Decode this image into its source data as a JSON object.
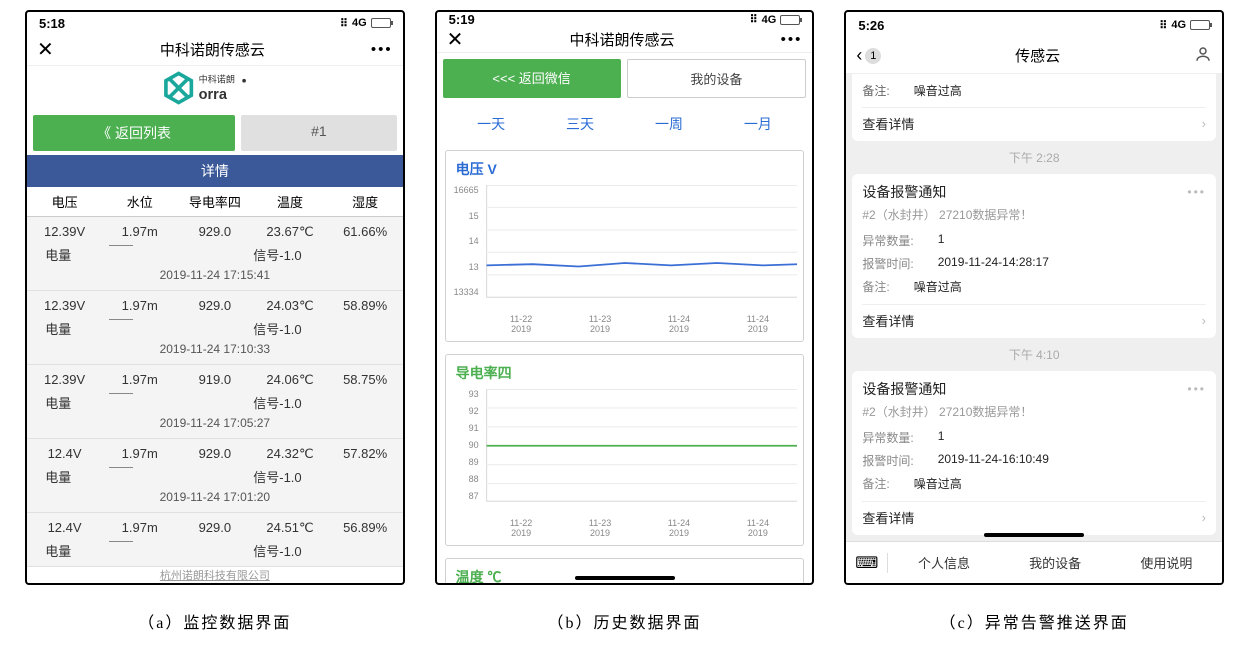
{
  "panelA": {
    "status_time": "5:18",
    "status_signal": "4G",
    "title": "中科诺朗传感云",
    "logo_text": "中科诺朗",
    "logo_sub": "orra",
    "btn_return": "《 返回列表",
    "btn_id": "#1",
    "details_header": "详情",
    "columns": [
      "电压",
      "水位",
      "导电率四",
      "温度",
      "湿度"
    ],
    "row2_label_left": "电量",
    "row2_label_signal": "信号-1.0",
    "records": [
      {
        "vals": [
          "12.39V",
          "1.97m",
          "929.0",
          "23.67℃",
          "61.66%"
        ],
        "ts": "2019-11-24 17:15:41"
      },
      {
        "vals": [
          "12.39V",
          "1.97m",
          "929.0",
          "24.03℃",
          "58.89%"
        ],
        "ts": "2019-11-24 17:10:33"
      },
      {
        "vals": [
          "12.39V",
          "1.97m",
          "919.0",
          "24.06℃",
          "58.75%"
        ],
        "ts": "2019-11-24 17:05:27"
      },
      {
        "vals": [
          "12.4V",
          "1.97m",
          "929.0",
          "24.32℃",
          "57.82%"
        ],
        "ts": "2019-11-24 17:01:20"
      },
      {
        "vals": [
          "12.4V",
          "1.97m",
          "929.0",
          "24.51℃",
          "56.89%"
        ],
        "ts": ""
      }
    ],
    "footer": "杭州诺朗科技有限公司"
  },
  "panelB": {
    "status_time": "5:19",
    "status_signal": "4G",
    "title": "中科诺朗传感云",
    "btn_return_wx": "<<< 返回微信",
    "btn_mydev": "我的设备",
    "tabs": [
      "一天",
      "三天",
      "一周",
      "一月"
    ],
    "chart1_title": "电压 V",
    "chart2_title": "导电率四",
    "chart3_title": "温度 ℃",
    "chart_data": [
      {
        "type": "line",
        "title": "电压 V",
        "ylim": [
          13334,
          16665
        ],
        "y_ticks": [
          "16665",
          "15",
          "14",
          "13",
          "13334"
        ],
        "x_ticks": [
          [
            "11-22",
            "2019"
          ],
          [
            "11-23",
            "2019"
          ],
          [
            "11-24",
            "2019"
          ],
          [
            "11-24",
            "2019"
          ]
        ],
        "series": [
          {
            "name": "电压",
            "color": "#3b6fd6",
            "approx_value": 12.4,
            "shape": "flat"
          }
        ]
      },
      {
        "type": "line",
        "title": "导电率四",
        "ylim": [
          87,
          93
        ],
        "y_ticks": [
          "93",
          "92",
          "91",
          "90",
          "89",
          "88",
          "87"
        ],
        "x_ticks": [
          [
            "11-22",
            "2019"
          ],
          [
            "11-23",
            "2019"
          ],
          [
            "11-24",
            "2019"
          ],
          [
            "11-24",
            "2019"
          ]
        ],
        "series": [
          {
            "name": "导电率四",
            "color": "#4caf50",
            "approx_value": 90,
            "shape": "flat"
          }
        ]
      }
    ]
  },
  "panelC": {
    "status_time": "5:26",
    "status_signal": "4G",
    "back_count": "1",
    "title": "传感云",
    "top_remark_label": "备注:",
    "top_remark_value": "噪音过高",
    "view_detail": "查看详情",
    "ts1": "下午 2:28",
    "ts2": "下午 4:10",
    "card_title": "设备报警通知",
    "card1_sub": "#2（水封井）   27210数据异常！",
    "label_count": "异常数量:",
    "label_time": "报警时间:",
    "label_remark": "备注:",
    "card1": {
      "count": "1",
      "time": "2019-11-24-14:28:17",
      "remark": "噪音过高"
    },
    "card2_sub": "#2（水封井）   27210数据异常！",
    "card2": {
      "count": "1",
      "time": "2019-11-24-16:10:49",
      "remark": "噪音过高"
    },
    "nav": [
      "个人信息",
      "我的设备",
      "使用说明"
    ]
  },
  "captions": {
    "a": "（a）监控数据界面",
    "b": "（b）历史数据界面",
    "c": "（c）异常告警推送界面"
  }
}
